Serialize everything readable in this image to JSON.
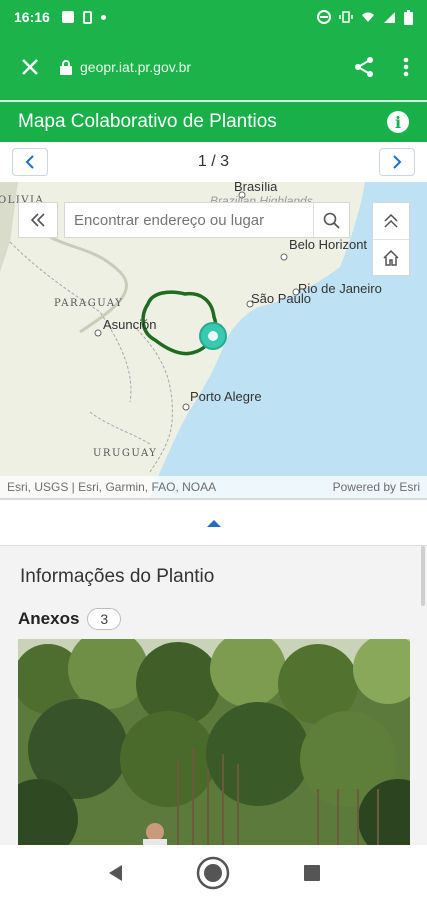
{
  "status": {
    "time": "16:16"
  },
  "browser": {
    "url": "geopr.iat.pr.gov.br"
  },
  "app": {
    "title": "Mapa Colaborativo de Plantios"
  },
  "pager": {
    "text": "1 / 3"
  },
  "map": {
    "search_placeholder": "Encontrar endereço ou lugar",
    "labels": {
      "brasilia": "Brasília",
      "highlands": "Brazilian Highlands",
      "belo_horizonte": "Belo Horizont",
      "rio": "Rio de Janeiro",
      "sao_paulo": "São Paulo",
      "paraguay": "PARAGUAY",
      "asuncion": "Asunción",
      "porto_alegre": "Porto Alegre",
      "uruguay": "URUGUAY",
      "bolivia": "OLIVIA"
    },
    "attribution": "Esri, USGS | Esri, Garmin, FAO, NOAA",
    "powered": "Powered by Esri",
    "colors": {
      "boundary": "#1f6b1f",
      "marker": "#38c9b0",
      "ocean": "#bfe1f4"
    }
  },
  "panel": {
    "title": "Informações do Plantio",
    "attachments_label": "Anexos",
    "attachments_count": "3"
  }
}
